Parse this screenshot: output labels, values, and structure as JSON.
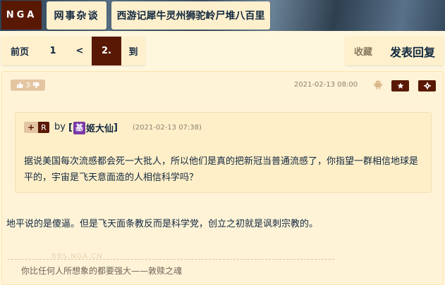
{
  "header": {
    "logo": "NGA",
    "crumbs": [
      "网事杂谈",
      "西游记犀牛灵州狮驼岭尸堆八百里"
    ]
  },
  "pager": {
    "first": "前页",
    "page1": "1",
    "prev": "<",
    "current": "2.",
    "goto": "到"
  },
  "actions": {
    "favorite": "收藏",
    "reply": "发表回复"
  },
  "post": {
    "likes": "3",
    "date": "2021-02-13 08:00",
    "quote": {
      "plus": "+",
      "r": "R",
      "by": "by",
      "user_bracket_open": "[",
      "user_badge": "基",
      "user_name": "姬大仙",
      "user_bracket_close": "]",
      "time": "(2021-02-13 07:38)",
      "text": "据说美国每次流感都会死一大批人，所以他们是真的把新冠当普通流感了，你指望一群相信地球是平的，宇宙是飞天意面造的人相信科学吗？"
    },
    "reply": "地平说的是傻逼。但是飞天面条教反而是科学党，创立之初就是讽刺宗教的。",
    "watermark": "BBS.NGA.CN",
    "signature": "你比任何人所想象的都要强大——敦赎之魂"
  },
  "colors": {
    "brand": "#591804",
    "background": "#fff7dd",
    "panel": "#fff0cd",
    "text": "#10273f"
  }
}
